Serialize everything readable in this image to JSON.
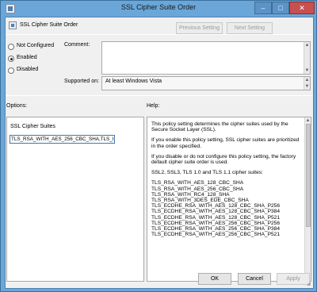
{
  "window": {
    "title": "SSL Cipher Suite Order",
    "controls": {
      "minimize": "–",
      "maximize": "□",
      "close": "✕"
    }
  },
  "header": {
    "title": "SSL Cipher Suite Order",
    "previous_label": "Previous Setting",
    "next_label": "Next Setting"
  },
  "state": {
    "options": [
      {
        "label": "Not Configured",
        "checked": false
      },
      {
        "label": "Enabled",
        "checked": true
      },
      {
        "label": "Disabled",
        "checked": false
      }
    ]
  },
  "comment": {
    "label": "Comment:",
    "value": ""
  },
  "supported": {
    "label": "Supported on:",
    "value": "At least Windows Vista"
  },
  "options_section": {
    "label": "Options:",
    "field_label": "SSL Cipher Suites",
    "field_value": "TLS_RSA_WITH_AES_256_CBC_SHA,TLS_I"
  },
  "help": {
    "label": "Help:",
    "paragraphs": [
      "This policy setting determines the cipher suites used by the Secure Socket Layer (SSL).",
      "If you enable this policy setting, SSL cipher suites are prioritized in the order specified.",
      "If you disable or do not configure this policy setting, the factory default cipher suite order is used.",
      "SSL2, SSL3, TLS 1.0 and TLS 1.1 cipher suites:"
    ],
    "suites": [
      "TLS_RSA_WITH_AES_128_CBC_SHA",
      "TLS_RSA_WITH_AES_256_CBC_SHA",
      "TLS_RSA_WITH_RC4_128_SHA",
      "TLS_RSA_WITH_3DES_EDE_CBC_SHA",
      "TLS_ECDHE_RSA_WITH_AES_128_CBC_SHA_P256",
      "TLS_ECDHE_RSA_WITH_AES_128_CBC_SHA_P384",
      "TLS_ECDHE_RSA_WITH_AES_128_CBC_SHA_P521",
      "TLS_ECDHE_RSA_WITH_AES_256_CBC_SHA_P256",
      "TLS_ECDHE_RSA_WITH_AES_256_CBC_SHA_P384",
      "TLS_ECDHE_RSA_WITH_AES_256_CBC_SHA_P521"
    ]
  },
  "footer": {
    "ok": "OK",
    "cancel": "Cancel",
    "apply": "Apply"
  }
}
